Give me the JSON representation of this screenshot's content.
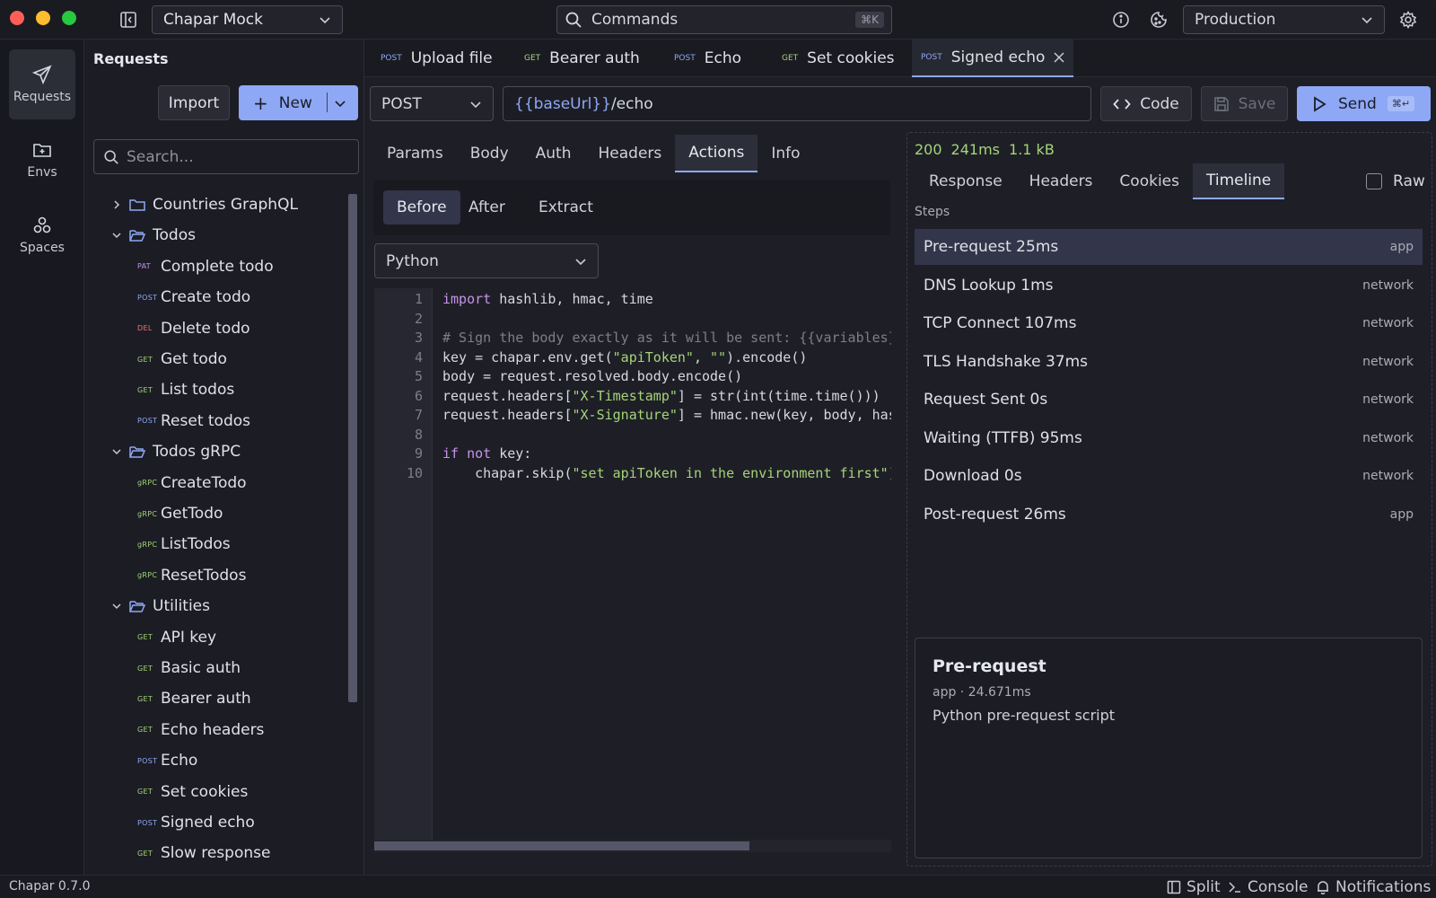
{
  "workspace": "Chapar Mock",
  "commands": {
    "label": "Commands",
    "shortcut": "⌘K"
  },
  "environment": "Production",
  "rail": {
    "requests": "Requests",
    "envs": "Envs",
    "spaces": "Spaces"
  },
  "panel": {
    "title": "Requests",
    "import_label": "Import",
    "new_label": "New",
    "search_placeholder": "Search..."
  },
  "tree": [
    {
      "type": "folder",
      "label": "Countries GraphQL",
      "open": false
    },
    {
      "type": "folder",
      "label": "Todos",
      "open": true
    },
    {
      "type": "leaf",
      "method": "PAT",
      "label": "Complete todo"
    },
    {
      "type": "leaf",
      "method": "POST",
      "label": "Create todo"
    },
    {
      "type": "leaf",
      "method": "DEL",
      "label": "Delete todo"
    },
    {
      "type": "leaf",
      "method": "GET",
      "label": "Get todo"
    },
    {
      "type": "leaf",
      "method": "GET",
      "label": "List todos"
    },
    {
      "type": "leaf",
      "method": "POST",
      "label": "Reset todos"
    },
    {
      "type": "folder",
      "label": "Todos gRPC",
      "open": true
    },
    {
      "type": "leaf",
      "method": "gRPC",
      "label": "CreateTodo"
    },
    {
      "type": "leaf",
      "method": "gRPC",
      "label": "GetTodo"
    },
    {
      "type": "leaf",
      "method": "gRPC",
      "label": "ListTodos"
    },
    {
      "type": "leaf",
      "method": "gRPC",
      "label": "ResetTodos"
    },
    {
      "type": "folder",
      "label": "Utilities",
      "open": true
    },
    {
      "type": "leaf",
      "method": "GET",
      "label": "API key"
    },
    {
      "type": "leaf",
      "method": "GET",
      "label": "Basic auth"
    },
    {
      "type": "leaf",
      "method": "GET",
      "label": "Bearer auth"
    },
    {
      "type": "leaf",
      "method": "GET",
      "label": "Echo headers"
    },
    {
      "type": "leaf",
      "method": "POST",
      "label": "Echo"
    },
    {
      "type": "leaf",
      "method": "GET",
      "label": "Set cookies"
    },
    {
      "type": "leaf",
      "method": "POST",
      "label": "Signed echo"
    },
    {
      "type": "leaf",
      "method": "GET",
      "label": "Slow response"
    }
  ],
  "method_colors": {
    "GET": "#a5d479",
    "POST": "#8ea8f5",
    "DEL": "#f07178",
    "PAT": "#c792ea",
    "gRPC": "#a5d479"
  },
  "tabs": [
    {
      "method": "POST",
      "label": "Upload file"
    },
    {
      "method": "GET",
      "label": "Bearer auth"
    },
    {
      "method": "POST",
      "label": "Echo"
    },
    {
      "method": "GET",
      "label": "Set cookies"
    },
    {
      "method": "POST",
      "label": "Signed echo",
      "active": true
    }
  ],
  "request": {
    "method": "POST",
    "url_var": "{{baseUrl}}",
    "url_path": "/echo",
    "code_label": "Code",
    "save_label": "Save",
    "send_label": "Send",
    "send_shortcut": "⌘↵"
  },
  "req_tabs": [
    "Params",
    "Body",
    "Auth",
    "Headers",
    "Actions",
    "Info"
  ],
  "phases": [
    "Before",
    "After",
    "Extract"
  ],
  "language": "Python",
  "code_lines": [
    "import hashlib, hmac, time",
    "",
    "# Sign the body exactly as it will be sent: {{variables}",
    "key = chapar.env.get(\"apiToken\", \"\").encode()",
    "body = request.resolved.body.encode()",
    "request.headers[\"X-Timestamp\"] = str(int(time.time()))",
    "request.headers[\"X-Signature\"] = hmac.new(key, body, has",
    "",
    "if not key:",
    "    chapar.skip(\"set apiToken in the environment first\")"
  ],
  "response": {
    "status": "200",
    "time": "241ms",
    "size": "1.1 kB",
    "tabs": [
      "Response",
      "Headers",
      "Cookies",
      "Timeline"
    ],
    "raw_label": "Raw",
    "steps_label": "Steps",
    "steps": [
      {
        "name": "Pre-request",
        "dur": "25ms",
        "kind": "app"
      },
      {
        "name": "DNS Lookup",
        "dur": "1ms",
        "kind": "network"
      },
      {
        "name": "TCP Connect",
        "dur": "107ms",
        "kind": "network"
      },
      {
        "name": "TLS Handshake",
        "dur": "37ms",
        "kind": "network"
      },
      {
        "name": "Request Sent",
        "dur": "0s",
        "kind": "network"
      },
      {
        "name": "Waiting (TTFB)",
        "dur": "95ms",
        "kind": "network"
      },
      {
        "name": "Download",
        "dur": "0s",
        "kind": "network"
      },
      {
        "name": "Post-request",
        "dur": "26ms",
        "kind": "app"
      }
    ],
    "detail": {
      "title": "Pre-request",
      "meta": "app · 24.671ms",
      "desc": "Python pre-request script"
    }
  },
  "statusbar": {
    "version": "Chapar 0.7.0",
    "split": "Split",
    "console": "Console",
    "notifications": "Notifications"
  }
}
